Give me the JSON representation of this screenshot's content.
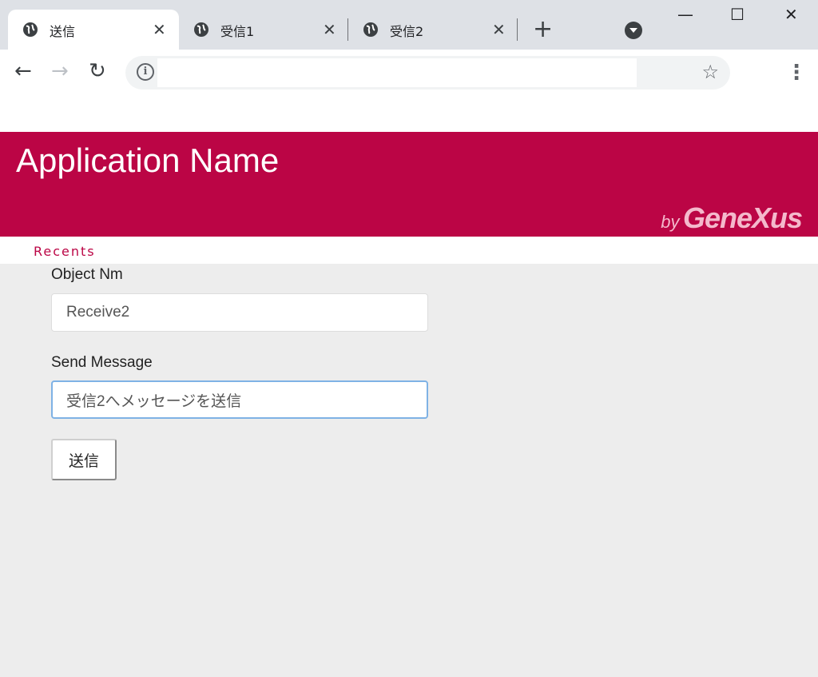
{
  "browser": {
    "tabs": [
      {
        "title": "送信",
        "close": "✕",
        "active": true
      },
      {
        "title": "受信1",
        "close": "✕",
        "active": false
      },
      {
        "title": "受信2",
        "close": "✕",
        "active": false
      }
    ],
    "new_tab": "+",
    "window": {
      "minimize": "—",
      "maximize": "☐",
      "close": "✕"
    },
    "toolbar": {
      "back": "←",
      "forward": "→",
      "reload": "↻",
      "info": "i",
      "url": "",
      "bookmark": "☆",
      "menu": "⋮"
    }
  },
  "app": {
    "title": "Application Name",
    "brand_by": "by",
    "brand_name": "GeneXus",
    "accent_color": "#bb0545"
  },
  "nav": {
    "recents": "Recents"
  },
  "form": {
    "object_label": "Object Nm",
    "object_value": "Receive2",
    "message_label": "Send Message",
    "message_value": "受信2へメッセージを送信",
    "send_button": "送信"
  }
}
